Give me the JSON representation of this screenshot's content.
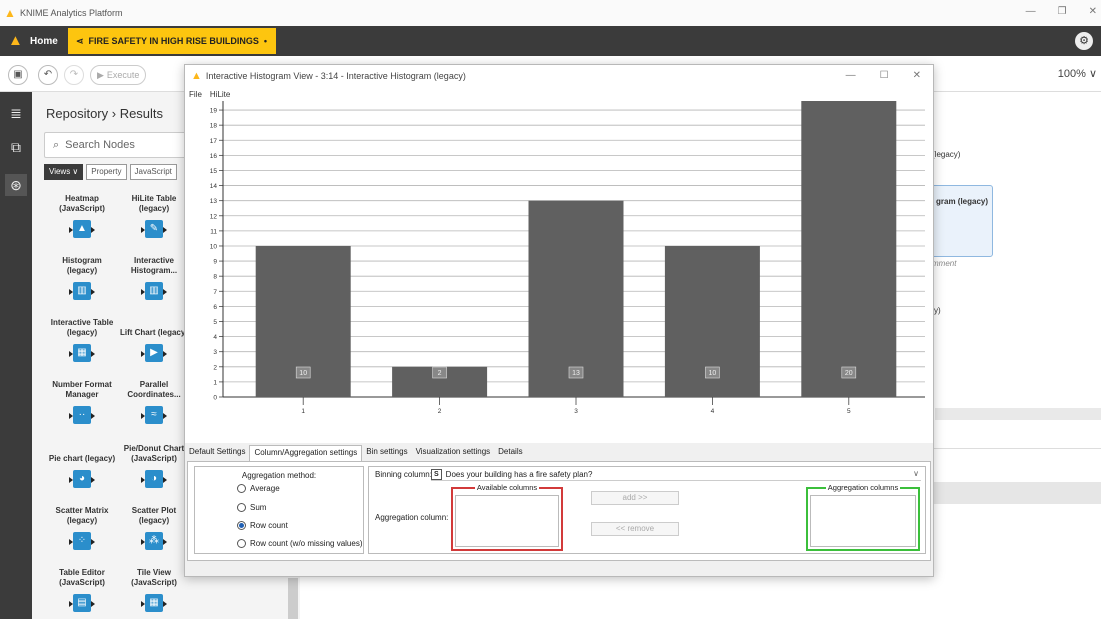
{
  "app": {
    "title": "KNIME Analytics Platform"
  },
  "tabs": {
    "home": "Home",
    "workflow": "FIRE SAFETY IN HIGH RISE BUILDINGS",
    "workflow_suffix": "•"
  },
  "toolbar": {
    "execute": "Execute",
    "zoom": "100% ∨"
  },
  "repository": {
    "breadcrumb": "Repository › Results",
    "search_placeholder": "Search Nodes",
    "chips": [
      "Views ∨",
      "Property",
      "JavaScript"
    ],
    "nodes": [
      {
        "name": "Heatmap (JavaScript)",
        "icon": "heatmap-icon",
        "glyph": "▲"
      },
      {
        "name": "HiLite Table (legacy)",
        "icon": "hilite-table-icon",
        "glyph": "✎"
      },
      {
        "name": "Histogram (legacy)",
        "icon": "histogram-icon",
        "glyph": "▥"
      },
      {
        "name": "Interactive Histogram...",
        "icon": "interactive-histogram-icon",
        "glyph": "▥"
      },
      {
        "name": "Interactive Table (legacy)",
        "icon": "interactive-table-icon",
        "glyph": "▦"
      },
      {
        "name": "Lift Chart (legacy)",
        "icon": "lift-chart-icon",
        "glyph": "▶"
      },
      {
        "name": "Number Format Manager",
        "icon": "number-format-icon",
        "glyph": "··"
      },
      {
        "name": "Parallel Coordinates...",
        "icon": "parallel-coordinates-icon",
        "glyph": "≈"
      },
      {
        "name": "Pie chart (legacy)",
        "icon": "pie-chart-icon",
        "glyph": "◕"
      },
      {
        "name": "Pie/Donut Chart (JavaScript)",
        "icon": "donut-chart-icon",
        "glyph": "◑"
      },
      {
        "name": "Scatter Matrix (legacy)",
        "icon": "scatter-matrix-icon",
        "glyph": "⁘"
      },
      {
        "name": "Scatter Plot (legacy)",
        "icon": "scatter-plot-icon",
        "glyph": "⁂"
      },
      {
        "name": "Table Editor (JavaScript)",
        "icon": "table-editor-icon",
        "glyph": "▤"
      },
      {
        "name": "Tile View (JavaScript)",
        "icon": "tile-view-icon",
        "glyph": "▦"
      }
    ]
  },
  "canvas": {
    "labels": [
      "(legacy)",
      "gram (legacy)",
      "mment",
      "y)"
    ]
  },
  "dialog": {
    "title": "Interactive Histogram View - 3:14 - Interactive Histogram (legacy)",
    "menu": [
      "File",
      "HiLite"
    ],
    "tabs": [
      "Default Settings",
      "Column/Aggregation settings",
      "Bin settings",
      "Visualization settings",
      "Details"
    ],
    "active_tab": 1,
    "aggregation": {
      "title": "Aggregation method:",
      "options": [
        "Average",
        "Sum",
        "Row count",
        "Row count (w/o missing values)"
      ],
      "selected": 2
    },
    "binning_label": "Binning column:",
    "binning_type": "S",
    "binning_value": "Does your building has a fire safety plan?",
    "aggregation_column_label": "Aggregation column:",
    "available_columns": "Available columns",
    "aggregation_columns": "Aggregation columns",
    "add_button": "add >>",
    "remove_button": "<< remove"
  },
  "chart_data": {
    "type": "bar",
    "categories": [
      "1",
      "2",
      "3",
      "4",
      "5"
    ],
    "values": [
      10,
      2,
      13,
      10,
      20
    ],
    "data_labels": [
      "10",
      "2",
      "13",
      "10",
      "20"
    ],
    "yticks": [
      0,
      1,
      2,
      3,
      4,
      5,
      6,
      7,
      8,
      9,
      10,
      11,
      12,
      13,
      14,
      15,
      16,
      17,
      18,
      19
    ],
    "ylim": [
      0,
      19.6
    ],
    "grid": true,
    "bar_color": "#606060"
  }
}
